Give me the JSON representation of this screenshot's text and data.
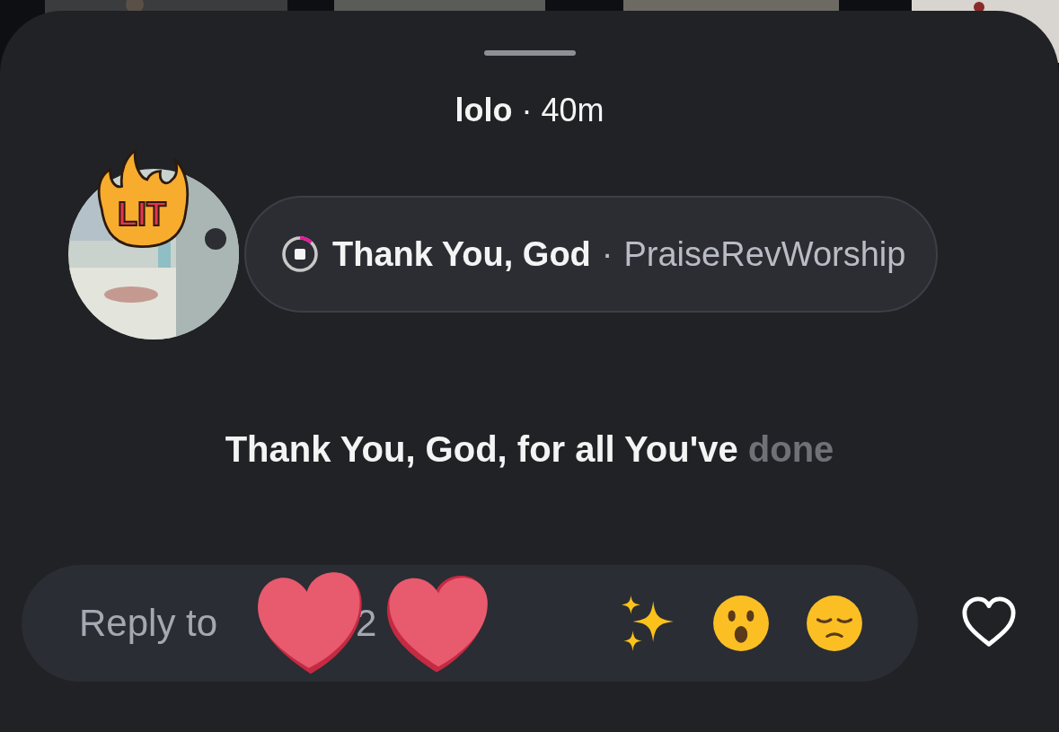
{
  "header": {
    "username": "lolo",
    "separator": "·",
    "time": "40m"
  },
  "sticker": {
    "text": "LIT"
  },
  "music": {
    "title": "Thank You, God",
    "separator": "·",
    "artist": "PraiseRevWorship",
    "level": 0.12
  },
  "lyric": {
    "sung": "Thank You, God, for all You've",
    "upcoming": "done"
  },
  "reply": {
    "placeholder": "Reply to",
    "visible_fragment": "2"
  },
  "reactions": [
    {
      "kind": "sparkles"
    },
    {
      "kind": "surprised"
    },
    {
      "kind": "pensive"
    }
  ],
  "like": {
    "selected": false
  }
}
